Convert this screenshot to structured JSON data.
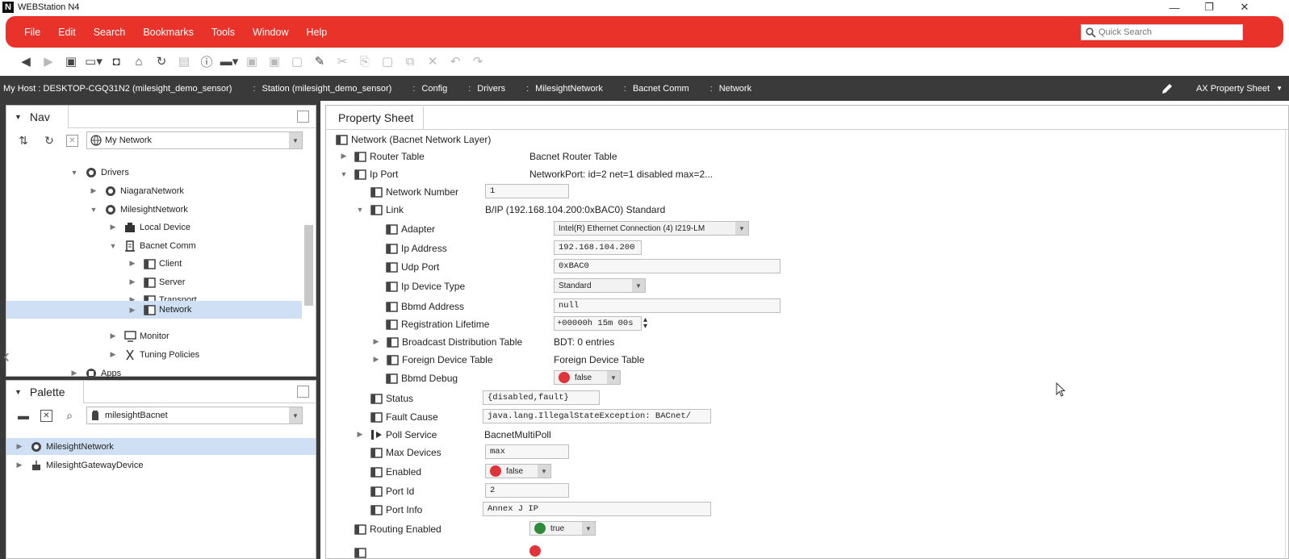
{
  "window": {
    "title": "WEBStation N4",
    "logo_letter": "N",
    "min": "—",
    "restore": "❐",
    "close": "✕"
  },
  "menu": [
    "File",
    "Edit",
    "Search",
    "Bookmarks",
    "Tools",
    "Window",
    "Help"
  ],
  "quick_search": {
    "placeholder": "Quick Search"
  },
  "path": {
    "crumbs": [
      "My Host : DESKTOP-CGQ31N2 (milesight_demo_sensor)",
      "Station (milesight_demo_sensor)",
      "Config",
      "Drivers",
      "MilesightNetwork",
      "Bacnet Comm",
      "Network"
    ],
    "view": "AX Property Sheet"
  },
  "nav": {
    "title": "Nav",
    "network_select": "My Network",
    "tree": [
      {
        "label": "Drivers",
        "icon": "drivers-icon",
        "expand": "open"
      },
      {
        "label": "NiagaraNetwork",
        "icon": "network-icon",
        "expand": "closed"
      },
      {
        "label": "MilesightNetwork",
        "icon": "network-icon",
        "expand": "open"
      },
      {
        "label": "Local Device",
        "icon": "device-icon",
        "expand": "closed"
      },
      {
        "label": "Bacnet Comm",
        "icon": "comm-icon",
        "expand": "open"
      },
      {
        "label": "Client",
        "icon": "folder-icon",
        "expand": "closed"
      },
      {
        "label": "Server",
        "icon": "folder-icon",
        "expand": "closed"
      },
      {
        "label": "Transport",
        "icon": "folder-icon",
        "expand": "closed"
      },
      {
        "label": "Network",
        "icon": "folder-icon",
        "expand": "closed"
      },
      {
        "label": "Monitor",
        "icon": "monitor-icon",
        "expand": "closed"
      },
      {
        "label": "Tuning Policies",
        "icon": "tuning-icon",
        "expand": "closed"
      },
      {
        "label": "Apps",
        "icon": "apps-icon",
        "expand": "closed"
      }
    ]
  },
  "palette": {
    "title": "Palette",
    "module_select": "milesightBacnet",
    "items": [
      {
        "label": "MilesightNetwork",
        "icon": "network-icon"
      },
      {
        "label": "MilesightGatewayDevice",
        "icon": "gateway-icon"
      }
    ]
  },
  "property_sheet": {
    "tab": "Property Sheet",
    "header": "Network  (Bacnet Network Layer)",
    "rows": {
      "router_table": {
        "name": "Router Table",
        "value": "Bacnet Router Table"
      },
      "ip_port": {
        "name": "Ip Port",
        "value": "NetworkPort: id=2 net=1 disabled max=2..."
      },
      "network_number": {
        "name": "Network Number",
        "value": "1"
      },
      "link": {
        "name": "Link",
        "value": "B/IP (192.168.104.200:0xBAC0) Standard"
      },
      "adapter": {
        "name": "Adapter",
        "value": "Intel(R) Ethernet Connection (4) I219-LM"
      },
      "ip_address": {
        "name": "Ip Address",
        "value": "192.168.104.200"
      },
      "udp_port": {
        "name": "Udp Port",
        "value": "0xBAC0"
      },
      "ip_device_type": {
        "name": "Ip Device Type",
        "value": "Standard"
      },
      "bbmd_address": {
        "name": "Bbmd Address",
        "value": "null"
      },
      "registration_lifetime": {
        "name": "Registration Lifetime",
        "value": "+00000h 15m 00s"
      },
      "bdt": {
        "name": "Broadcast Distribution Table",
        "value": "BDT: 0 entries"
      },
      "fdt": {
        "name": "Foreign Device Table",
        "value": "Foreign Device Table"
      },
      "bbmd_debug": {
        "name": "Bbmd Debug",
        "value": "false"
      },
      "status": {
        "name": "Status",
        "value": "{disabled,fault}"
      },
      "fault_cause": {
        "name": "Fault Cause",
        "value": "java.lang.IllegalStateException: BACnet/"
      },
      "poll_service": {
        "name": "Poll Service",
        "value": "BacnetMultiPoll"
      },
      "max_devices": {
        "name": "Max Devices",
        "value": "max"
      },
      "enabled": {
        "name": "Enabled",
        "value": "false"
      },
      "port_id": {
        "name": "Port Id",
        "value": "2"
      },
      "port_info": {
        "name": "Port Info",
        "value": "Annex J IP"
      },
      "routing_enabled": {
        "name": "Routing Enabled",
        "value": "true"
      }
    }
  },
  "colors": {
    "menubar": "#e8322a",
    "pathbar": "#3a3a3a",
    "selected_row": "#cfe0f5",
    "false_dot": "#e0333a",
    "true_dot": "#2e8b3a"
  }
}
